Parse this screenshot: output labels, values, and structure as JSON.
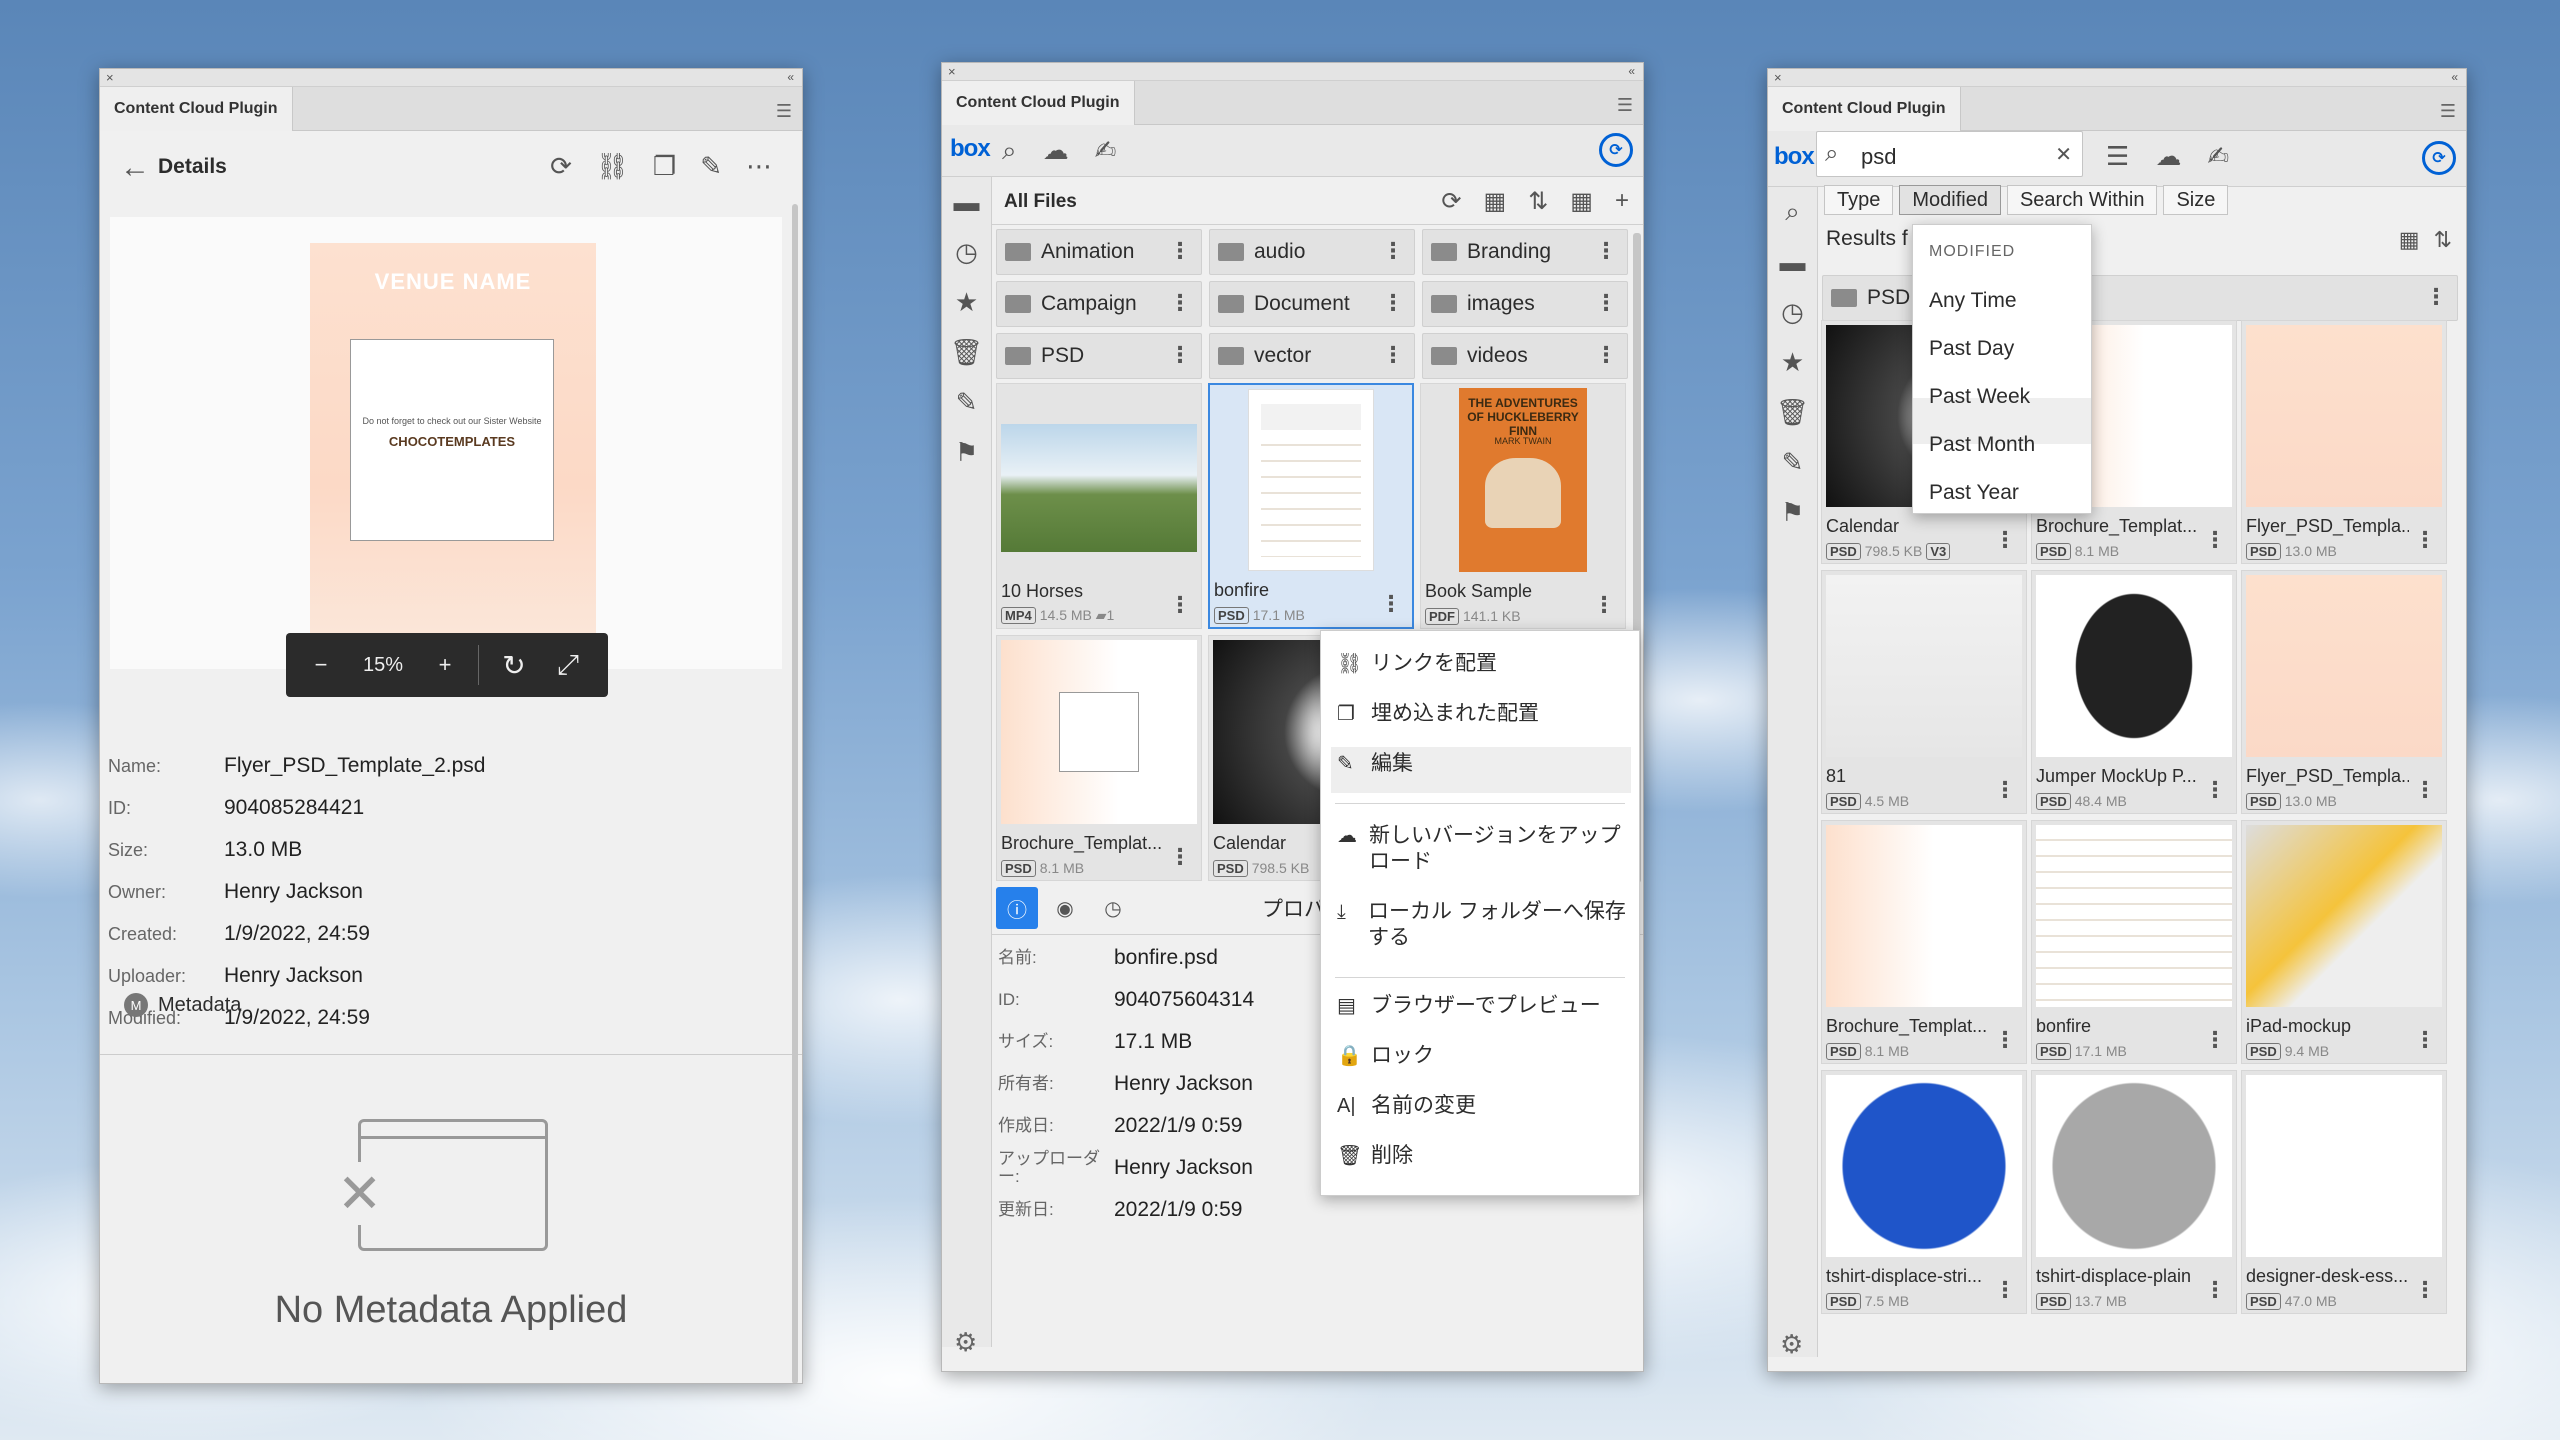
{
  "panel_title": "Content Cloud Plugin",
  "p1": {
    "header": "Details",
    "flyer": {
      "venue": "VENUE NAME",
      "subtitle": "Do not forget to check out our Sister Website",
      "brand": "CHOCOTEMPLATES"
    },
    "zoom": {
      "minus": "−",
      "level": "15%",
      "plus": "+"
    },
    "props": [
      {
        "k": "Name:",
        "v": "Flyer_PSD_Template_2.psd"
      },
      {
        "k": "ID:",
        "v": "904085284421"
      },
      {
        "k": "Size:",
        "v": "13.0 MB"
      },
      {
        "k": "Owner:",
        "v": "Henry Jackson"
      },
      {
        "k": "Created:",
        "v": "1/9/2022, 24:59"
      },
      {
        "k": "Uploader:",
        "v": "Henry Jackson"
      },
      {
        "k": "Modified:",
        "v": "1/9/2022, 24:59"
      }
    ],
    "metadata_label": "Metadata",
    "no_metadata": "No Metadata Applied"
  },
  "p2": {
    "logo": "box",
    "crumb": "All Files",
    "folders": [
      "Animation",
      "audio",
      "Branding",
      "Campaign",
      "Document",
      "images",
      "PSD",
      "vector",
      "videos"
    ],
    "files": [
      {
        "name": "10 Horses",
        "type": "MP4",
        "size": "14.5 MB",
        "extra": "1"
      },
      {
        "name": "bonfire",
        "type": "PSD",
        "size": "17.1 MB"
      },
      {
        "name": "Book Sample",
        "type": "PDF",
        "size": "141.1 KB"
      },
      {
        "name": "Brochure_Templat...",
        "type": "PSD",
        "size": "8.1 MB"
      },
      {
        "name": "Calendar",
        "type": "PSD",
        "size": "798.5 KB"
      }
    ],
    "book_cover": "THE ADVENTURES OF HUCKLEBERRY FINN",
    "book_author": "MARK TWAIN",
    "menu": [
      "リンクを配置",
      "埋め込まれた配置",
      "編集",
      "新しいバージョンをアップロード",
      "ローカル フォルダーへ保存する",
      "ブラウザーでプレビュー",
      "ロック",
      "名前の変更",
      "削除"
    ],
    "props_title": "プロパティ",
    "props": [
      {
        "k": "名前:",
        "v": "bonfire.psd"
      },
      {
        "k": "ID:",
        "v": "904075604314"
      },
      {
        "k": "サイズ:",
        "v": "17.1 MB"
      },
      {
        "k": "所有者:",
        "v": "Henry Jackson"
      },
      {
        "k": "作成日:",
        "v": "2022/1/9 0:59"
      },
      {
        "k": "アップローダー:",
        "v": "Henry Jackson"
      },
      {
        "k": "更新日:",
        "v": "2022/1/9 0:59"
      }
    ]
  },
  "p3": {
    "search": "psd",
    "filters": [
      "Type",
      "Modified",
      "Search Within",
      "Size"
    ],
    "results_label": "Results f",
    "folder": "PSD",
    "dropdown": {
      "header": "MODIFIED",
      "options": [
        "Any Time",
        "Past Day",
        "Past Week",
        "Past Month",
        "Past Year"
      ]
    },
    "files": [
      {
        "name": "Calendar",
        "type": "PSD",
        "size": "798.5 KB",
        "ver": "V3"
      },
      {
        "name": "Brochure_Templat...",
        "type": "PSD",
        "size": "8.1 MB"
      },
      {
        "name": "Flyer_PSD_Templa...",
        "type": "PSD",
        "size": "13.0 MB"
      },
      {
        "name": "81",
        "type": "PSD",
        "size": "4.5 MB"
      },
      {
        "name": "Jumper MockUp P...",
        "type": "PSD",
        "size": "48.4 MB"
      },
      {
        "name": "Flyer_PSD_Templa...",
        "type": "PSD",
        "size": "13.0 MB"
      },
      {
        "name": "Brochure_Templat...",
        "type": "PSD",
        "size": "8.1 MB"
      },
      {
        "name": "bonfire",
        "type": "PSD",
        "size": "17.1 MB"
      },
      {
        "name": "iPad-mockup",
        "type": "PSD",
        "size": "9.4 MB"
      },
      {
        "name": "tshirt-displace-stri...",
        "type": "PSD",
        "size": "7.5 MB"
      },
      {
        "name": "tshirt-displace-plain",
        "type": "PSD",
        "size": "13.7 MB"
      },
      {
        "name": "designer-desk-ess...",
        "type": "PSD",
        "size": "47.0 MB"
      }
    ]
  },
  "colors": {
    "accent": "#0061d5",
    "selection": "#3b88e0"
  }
}
